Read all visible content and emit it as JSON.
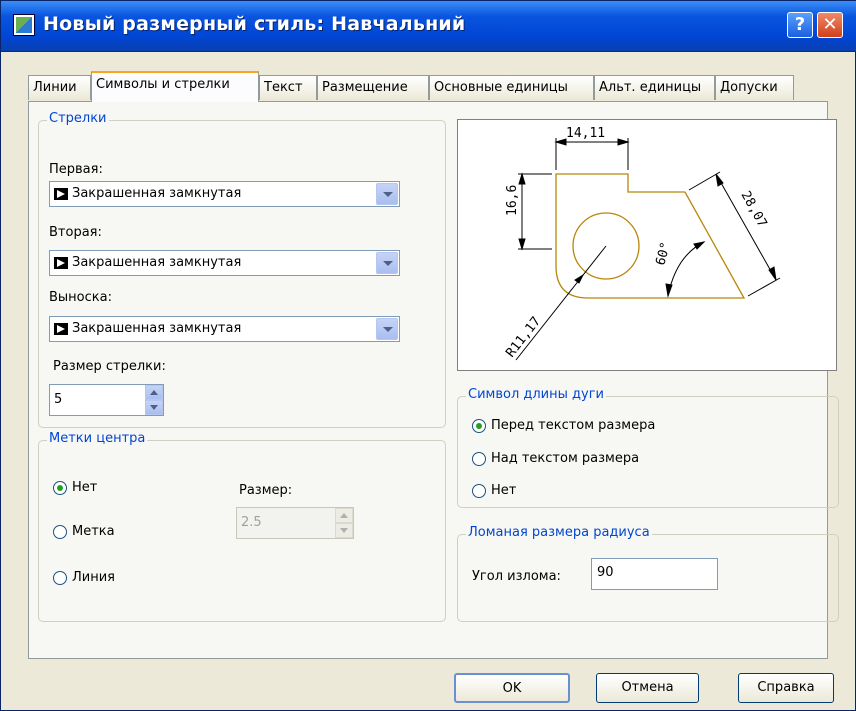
{
  "window": {
    "title": "Новый размерный стиль: Навчальний",
    "help_glyph": "?",
    "close_glyph": "✕"
  },
  "tabs": [
    {
      "label": "Линии"
    },
    {
      "label": "Символы и стрелки"
    },
    {
      "label": "Текст"
    },
    {
      "label": "Размещение"
    },
    {
      "label": "Основные единицы"
    },
    {
      "label": "Альт. единицы"
    },
    {
      "label": "Допуски"
    }
  ],
  "arrows": {
    "title": "Стрелки",
    "first_label": "Первая:",
    "first_value": "Закрашенная замкнутая",
    "second_label": "Вторая:",
    "second_value": "Закрашенная замкнутая",
    "leader_label": "Выноска:",
    "leader_value": "Закрашенная замкнутая",
    "size_label": "Размер стрелки:",
    "size_value": "5"
  },
  "center_marks": {
    "title": "Метки центра",
    "options": [
      {
        "label": "Нет",
        "selected": true
      },
      {
        "label": "Метка",
        "selected": false
      },
      {
        "label": "Линия",
        "selected": false
      }
    ],
    "size_label": "Размер:",
    "size_value": "2.5"
  },
  "preview": {
    "dim_top": "14,11",
    "dim_left": "16,6",
    "dim_slant": "28,07",
    "angle": "60°",
    "radius": "R11,17",
    "shape_color": "#b8860b"
  },
  "arc_symbol": {
    "title": "Символ длины дуги",
    "options": [
      {
        "label": "Перед текстом размера",
        "selected": true
      },
      {
        "label": "Над текстом размера",
        "selected": false
      },
      {
        "label": "Нет",
        "selected": false
      }
    ]
  },
  "radius_jog": {
    "title": "Ломаная размера радиуса",
    "angle_label": "Угол излома:",
    "angle_value": "90"
  },
  "buttons": {
    "ok": "OK",
    "cancel": "Отмена",
    "help": "Справка"
  }
}
